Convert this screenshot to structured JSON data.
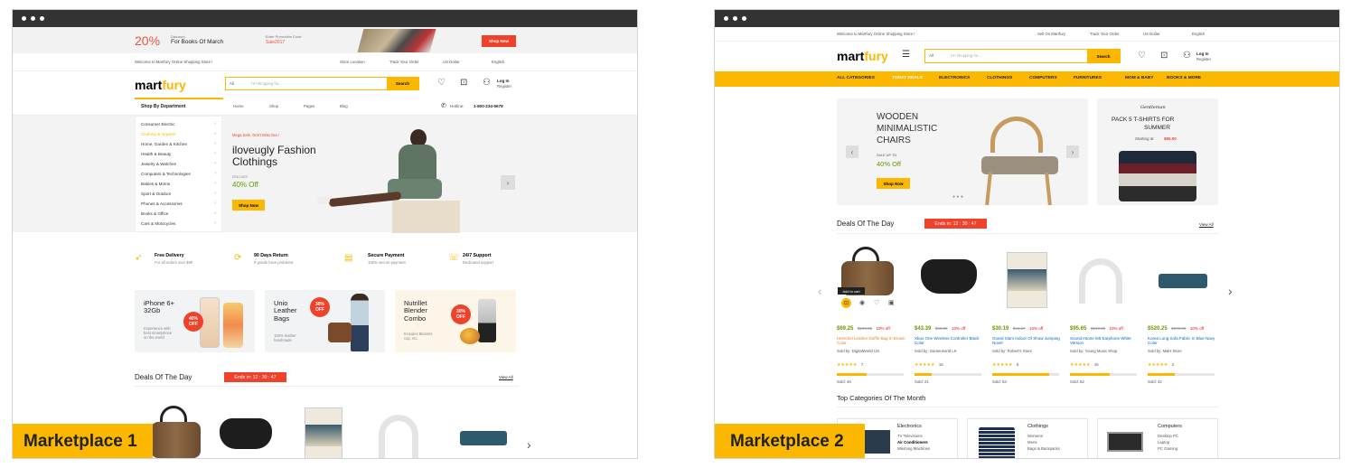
{
  "window1": {
    "badge": "Marketplace 1",
    "promo": {
      "percent": "20%",
      "discount_label": "Discount",
      "headline": "For Books Of March",
      "code_label": "Enter Promotion Code",
      "code": "Sale2017",
      "button": "Shop Now"
    },
    "topbar": {
      "welcome": "Welcome to Martfury Online Shopping Store !",
      "store_location": "Store Location",
      "track_order": "Track Your Order",
      "currency": "US Dollar",
      "language": "English"
    },
    "logo": {
      "part1": "mart",
      "part2": "fury"
    },
    "search": {
      "category": "All",
      "placeholder": "I'm shopping for...",
      "button": "Search"
    },
    "account": {
      "login": "Log In",
      "register": "Register"
    },
    "nav": {
      "dept": "Shop By Department",
      "links": [
        "Home",
        "Shop",
        "Pages",
        "Blog"
      ],
      "hotline_label": "Hotline:",
      "hotline": "1-800-234-5678"
    },
    "departments": [
      "Consumer Electric",
      "Clothing & Apparel",
      "Home, Garden & Kitchen",
      "Health & Beauty",
      "Jewelry & Watches",
      "Computers & Technologies",
      "Babies & Moms",
      "Sport & Outdoor",
      "Phones & Accessories",
      "Books & Office",
      "Cars & Motocycles"
    ],
    "hero": {
      "kicker": "Mega Sale, Don't Miss Out !",
      "title_line1": "iloveugly Fashion",
      "title_line2": "Clothings",
      "discount_label": "Discount",
      "discount": "40% Off",
      "button": "Shop Now"
    },
    "features": [
      {
        "icon": "rocket-icon",
        "title": "Free Delivery",
        "sub": "For all orders over $99"
      },
      {
        "icon": "sync-icon",
        "title": "90 Days Return",
        "sub": "If goods have problems"
      },
      {
        "icon": "credit-card-icon",
        "title": "Secure Payment",
        "sub": "100% secure payment"
      },
      {
        "icon": "support-icon",
        "title": "24/7 Support",
        "sub": "Dedicated support"
      }
    ],
    "promos": [
      {
        "title": "iPhone 6+\n32Gb",
        "sub": "Experience with\nbest smartphone\non the world",
        "pct": "40%",
        "off": "OFF"
      },
      {
        "title": "Unio\nLeather\nBags",
        "sub": "100% leather\nhandmade",
        "pct": "30%",
        "off": "OFF"
      },
      {
        "title": "Nutrillet\nBlender\nCombo",
        "sub": "Includes Blender,\ncup, etc.",
        "pct": "30%",
        "off": "OFF"
      }
    ],
    "deals": {
      "title": "Deals Of The Day",
      "ends": "Ends in: 12 : 30 : 47",
      "view_all": "View All"
    }
  },
  "window2": {
    "badge": "Marketplace 2",
    "topbar": {
      "welcome": "Welcome to Martfury Online Shopping Store !",
      "sell": "Sell On Martfury",
      "track_order": "Track Your Order",
      "currency": "US Dollar",
      "language": "English"
    },
    "logo": {
      "part1": "mart",
      "part2": "fury"
    },
    "search": {
      "category": "All",
      "placeholder": "I'm shopping for...",
      "button": "Search"
    },
    "account": {
      "login": "Log In",
      "register": "Register"
    },
    "categories": [
      "ALL CATEGORIES",
      "TODAY DEALS",
      "ELECTRONICS",
      "CLOTHINGS",
      "COMPUTERS",
      "FURNITURES",
      "MOM & BABY",
      "BOOKS & MORE"
    ],
    "hero": {
      "title_line1": "WOODEN",
      "title_line2": "MINIMALISTIC",
      "title_line3": "CHAIRS",
      "sale_label": "SALE UP TO",
      "discount": "40% Off",
      "button": "Shop Now"
    },
    "side_banner": {
      "brand": "Gentleman",
      "title_line1": "PACK 5 T-SHIRTS FOR",
      "title_line2": "SUMMER",
      "starting": "Starting at",
      "price": "$90.00"
    },
    "deals": {
      "title": "Deals Of The Day",
      "ends": "Ends in: 12 : 30 : 47",
      "view_all": "View All"
    },
    "add_to_cart": "Add to cart",
    "products": [
      {
        "price": "$69.25",
        "old": "$109.25",
        "off": "10% off",
        "name": "Herschel Leather Duffle Bag In Brown Color",
        "vendor": "Sold by: DigitalWorld US",
        "rating": "7",
        "sold": "Sold: 46",
        "progress": 0.45
      },
      {
        "price": "$43.39",
        "old": "$65.39",
        "off": "10% off",
        "name": "Xbox One Wireless Controller Black Color",
        "vendor": "Sold by: Gamerworld LK",
        "rating": "16",
        "sold": "Sold: 21",
        "progress": 0.25
      },
      {
        "price": "$30.19",
        "old": "$41.27",
        "off": "10% off",
        "name": "Grand Slam Indoor Of Show Jumping Novel",
        "vendor": "Sold by: Robert's Store",
        "rating": "6",
        "sold": "Sold: 63",
        "progress": 0.85
      },
      {
        "price": "$95.65",
        "old": "$150.00",
        "off": "10% off",
        "name": "Sound Intone I65 Earphone White Version",
        "vendor": "Sold by: Young Music Shop",
        "rating": "16",
        "sold": "Sold: 62",
        "progress": 0.6
      },
      {
        "price": "$520.25",
        "old": "$575.99",
        "off": "10% off",
        "name": "Korea Long Sofa Fabric In Blue Navy Color",
        "vendor": "Sold by: M&H Store",
        "rating": "2",
        "sold": "Sold: 42",
        "progress": 0.4
      }
    ],
    "top_categories": {
      "title": "Top Categories Of The Month",
      "cards": [
        {
          "name": "Electronics",
          "items": [
            "TV Televisions",
            "Air Conditioners",
            "Washing Machines"
          ]
        },
        {
          "name": "Clothings",
          "items": [
            "Womens",
            "Mens",
            "Bags & Backpacks"
          ]
        },
        {
          "name": "Computers",
          "items": [
            "Desktop PC",
            "Laptop",
            "PC Gaming"
          ]
        }
      ]
    }
  },
  "colors": {
    "accent": "#fcb800",
    "chrome": "#333333",
    "price_green": "#669900",
    "deal_red": "#f0412b"
  }
}
